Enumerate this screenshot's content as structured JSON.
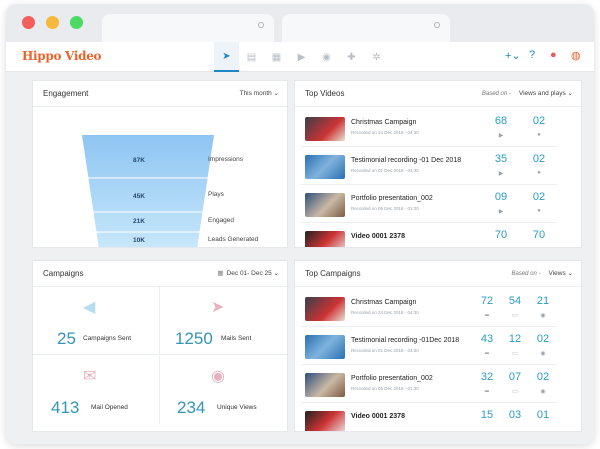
{
  "logo": "Hippo Video",
  "engagement": {
    "title": "Engagement",
    "period": "This month ⌄",
    "funnel": [
      {
        "value": "87K",
        "label": "Impressions"
      },
      {
        "value": "45K",
        "label": "Plays"
      },
      {
        "value": "21K",
        "label": "Engaged"
      },
      {
        "value": "10K",
        "label": "Leads Generated"
      }
    ]
  },
  "top_videos": {
    "title": "Top Videos",
    "based_on": "Based on -",
    "metric": "Views and plays ⌄",
    "rows": [
      {
        "title": "Christmas Campaign",
        "sub": "Recorded on 24 Dec 2018 - 04:30",
        "a": "68",
        "b": "02"
      },
      {
        "title": "Testimonial recording -01 Dec 2018",
        "sub": "Recorded on 01 Dec 2018 - 04:30",
        "a": "35",
        "b": "02"
      },
      {
        "title": "Portfolio presentation_002",
        "sub": "Recorded on 05 Dec 2018 - 01:30",
        "a": "09",
        "b": "02"
      },
      {
        "title": "Video 0001 2378",
        "sub": "",
        "a": "70",
        "b": "70"
      }
    ]
  },
  "campaigns": {
    "title": "Campaigns",
    "date_range": "Dec 01- Dec 25 ⌄",
    "stats": [
      {
        "value": "25",
        "label": "Campaigns Sent"
      },
      {
        "value": "1250",
        "label": "Mails Sent"
      },
      {
        "value": "413",
        "label": "Mail Opened"
      },
      {
        "value": "234",
        "label": "Unique Views"
      }
    ]
  },
  "top_campaigns": {
    "title": "Top Campaigns",
    "based_on": "Based on -",
    "metric": "Views ⌄",
    "rows": [
      {
        "title": "Christmas Campaign",
        "sub": "Recorded on 24 Dec 2018 - 04:30",
        "a": "72",
        "b": "54",
        "c": "21"
      },
      {
        "title": "Testimonial recording -01Dec 2018",
        "sub": "Recorded on 01 Dec 2018 - 04:30",
        "a": "43",
        "b": "12",
        "c": "02"
      },
      {
        "title": "Portfolio presentation_002",
        "sub": "Recorded on 05 Dec 2018 - 01:30",
        "a": "32",
        "b": "07",
        "c": "02"
      },
      {
        "title": "Video 0001 2378",
        "sub": "",
        "a": "15",
        "b": "03",
        "c": "01"
      }
    ]
  }
}
